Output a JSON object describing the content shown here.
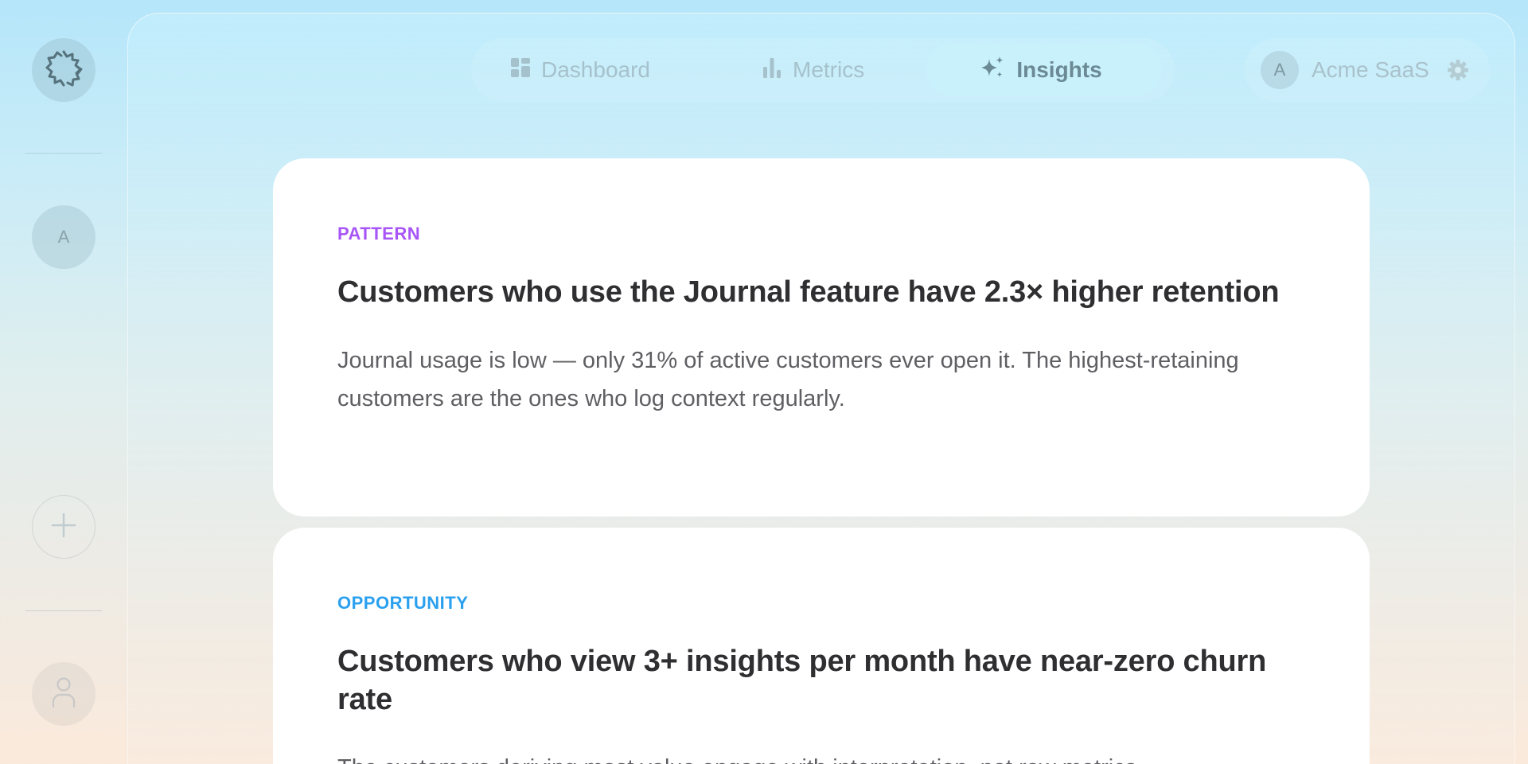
{
  "sidebar": {
    "logo_icon": "spiky-refresh-logo-icon",
    "avatar_initial": "A",
    "add_icon": "plus-icon",
    "user_icon": "person-icon"
  },
  "nav": {
    "items": [
      {
        "label": "Dashboard",
        "icon": "grid-icon",
        "active": false
      },
      {
        "label": "Metrics",
        "icon": "bar-chart-icon",
        "active": false
      },
      {
        "label": "Insights",
        "icon": "sparkles-icon",
        "active": true
      }
    ]
  },
  "org": {
    "initial": "A",
    "name": "Acme SaaS",
    "settings_icon": "gear-icon"
  },
  "insights": [
    {
      "tag": "PATTERN",
      "tag_color": "#a855f7",
      "title": "Customers who use the Journal feature have 2.3× higher retention",
      "body": "Journal usage is low — only 31% of active customers ever open it. The highest-retaining customers are the ones who log context regularly."
    },
    {
      "tag": "OPPORTUNITY",
      "tag_color": "#2aa0ef",
      "title": "Customers who view 3+ insights per month have near-zero churn rate",
      "body": "The customers deriving most value engage with interpretation, not raw metrics."
    }
  ]
}
